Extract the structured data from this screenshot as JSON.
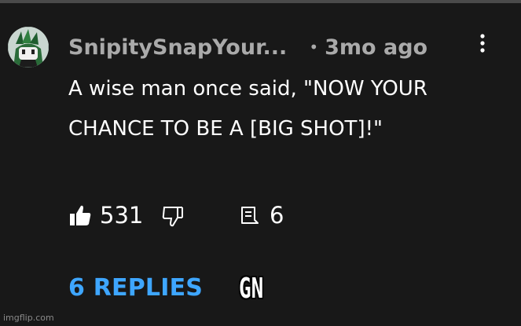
{
  "comment": {
    "author": "SnipitySnapYour...",
    "separator": "•",
    "timestamp": "3mo ago",
    "text": "A wise man once said, \"NOW YOUR CHANCE TO BE A [BIG SHOT]!\"",
    "like_count": "531",
    "reply_count": "6",
    "replies_link": "6 REPLIES",
    "icons": {
      "avatar": "avatar-image",
      "more": "more-vertical-icon",
      "like": "thumbs-up-icon",
      "dislike": "thumbs-down-icon",
      "reply": "comment-icon"
    }
  },
  "overlay": {
    "caption": "GN",
    "watermark": "imgflip.com"
  },
  "colors": {
    "background": "#181818",
    "text": "#ffffff",
    "secondary": "#aaaaaa",
    "link": "#3ea6ff"
  }
}
